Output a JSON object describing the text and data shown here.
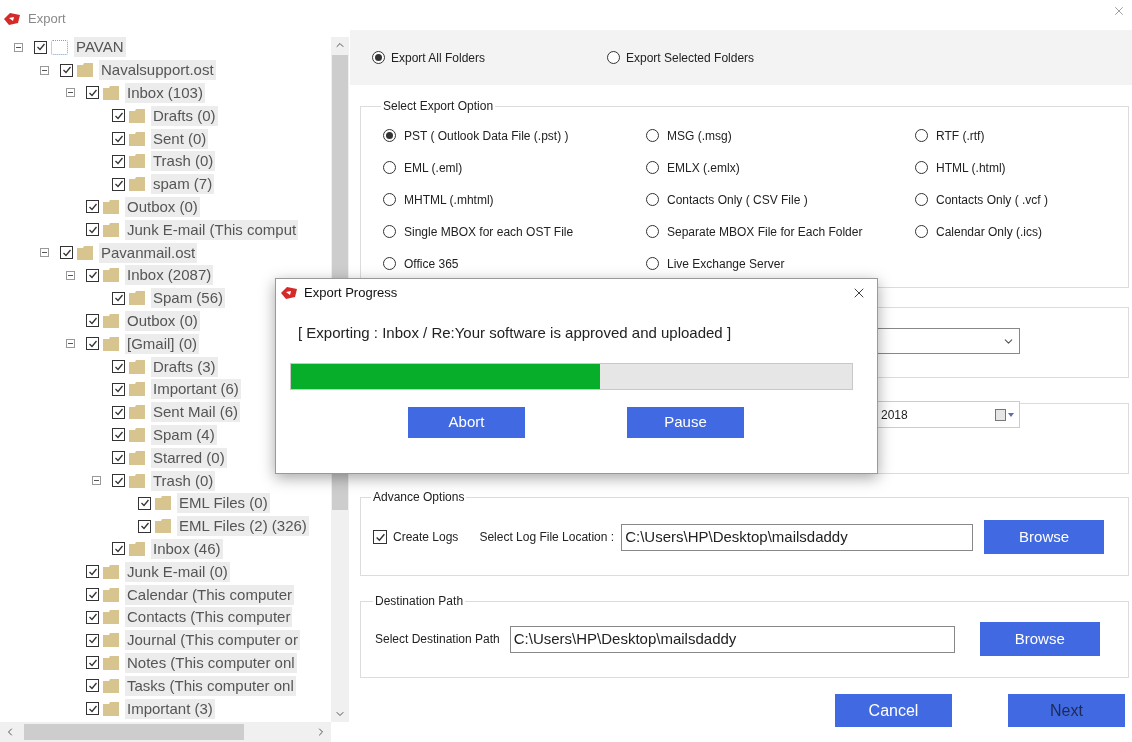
{
  "window": {
    "title": "Export"
  },
  "tree": {
    "label": "PAVAN",
    "checked": true,
    "expanded": true,
    "children": [
      {
        "label": "Navalsupport.ost",
        "checked": true,
        "expanded": true,
        "children": [
          {
            "label": "Inbox (103)",
            "checked": true,
            "expanded": true,
            "children": [
              {
                "label": "Drafts (0)",
                "checked": true
              },
              {
                "label": "Sent (0)",
                "checked": true
              },
              {
                "label": "Trash (0)",
                "checked": true
              },
              {
                "label": "spam (7)",
                "checked": true
              }
            ]
          },
          {
            "label": "Outbox (0)",
            "checked": true
          },
          {
            "label": "Junk E-mail (This comput",
            "checked": true
          }
        ]
      },
      {
        "label": "Pavanmail.ost",
        "checked": true,
        "expanded": true,
        "children": [
          {
            "label": "Inbox (2087)",
            "checked": true,
            "expanded": true,
            "children": [
              {
                "label": "Spam (56)",
                "checked": true
              }
            ]
          },
          {
            "label": "Outbox (0)",
            "checked": true
          },
          {
            "label": "[Gmail] (0)",
            "checked": true,
            "expanded": true,
            "children": [
              {
                "label": "Drafts (3)",
                "checked": true
              },
              {
                "label": "Important (6)",
                "checked": true
              },
              {
                "label": "Sent Mail (6)",
                "checked": true
              },
              {
                "label": "Spam (4)",
                "checked": true
              },
              {
                "label": "Starred (0)",
                "checked": true
              },
              {
                "label": "Trash (0)",
                "checked": true,
                "expanded": true,
                "children": [
                  {
                    "label": "EML Files (0)",
                    "checked": true
                  },
                  {
                    "label": "EML Files (2) (326)",
                    "checked": true
                  }
                ]
              },
              {
                "label": "Inbox (46)",
                "checked": true
              }
            ]
          },
          {
            "label": "Junk E-mail (0)",
            "checked": true
          },
          {
            "label": "Calendar (This computer",
            "checked": true
          },
          {
            "label": "Contacts (This computer",
            "checked": true
          },
          {
            "label": "Journal (This computer or",
            "checked": true
          },
          {
            "label": "Notes (This computer onl",
            "checked": true
          },
          {
            "label": "Tasks (This computer onl",
            "checked": true
          },
          {
            "label": "Important (3)",
            "checked": true
          }
        ]
      }
    ]
  },
  "scope_options": [
    {
      "label": "Export All Folders",
      "selected": true
    },
    {
      "label": "Export Selected Folders",
      "selected": false
    }
  ],
  "export_options": {
    "legend": "Select Export Option",
    "options": [
      {
        "label": "PST ( Outlook Data File (.pst) )",
        "selected": true
      },
      {
        "label": "MSG  (.msg)",
        "selected": false
      },
      {
        "label": "RTF  (.rtf)",
        "selected": false
      },
      {
        "label": "EML  (.eml)",
        "selected": false
      },
      {
        "label": "EMLX  (.emlx)",
        "selected": false
      },
      {
        "label": "HTML  (.html)",
        "selected": false
      },
      {
        "label": "MHTML (.mhtml)",
        "selected": false
      },
      {
        "label": "Contacts Only  ( CSV File )",
        "selected": false
      },
      {
        "label": "Contacts Only  ( .vcf )",
        "selected": false
      },
      {
        "label": "Single MBOX for each OST File",
        "selected": false
      },
      {
        "label": "Separate MBOX File for Each Folder",
        "selected": false
      },
      {
        "label": "Calendar Only  (.ics)",
        "selected": false
      },
      {
        "label": "Office 365",
        "selected": false
      },
      {
        "label": "Live Exchange Server",
        "selected": false
      }
    ]
  },
  "date_field": {
    "value": "2018"
  },
  "advance_options": {
    "legend": "Advance Options",
    "create_logs": {
      "label": "Create Logs",
      "checked": true
    },
    "location_label": "Select Log File Location :",
    "location": "C:\\Users\\HP\\Desktop\\mailsdaddy",
    "browse": "Browse"
  },
  "destination": {
    "legend": "Destination Path",
    "label": "Select Destination Path",
    "value": "C:\\Users\\HP\\Desktop\\mailsdaddy",
    "browse": "Browse"
  },
  "footer_buttons": [
    {
      "label": "Cancel"
    },
    {
      "label": "Next"
    }
  ],
  "progress_dialog": {
    "title": "Export Progress",
    "message": "[ Exporting : Inbox / Re:Your software is approved and uploaded ]",
    "level": 0.55,
    "buttons": [
      "Abort",
      "Pause"
    ]
  }
}
